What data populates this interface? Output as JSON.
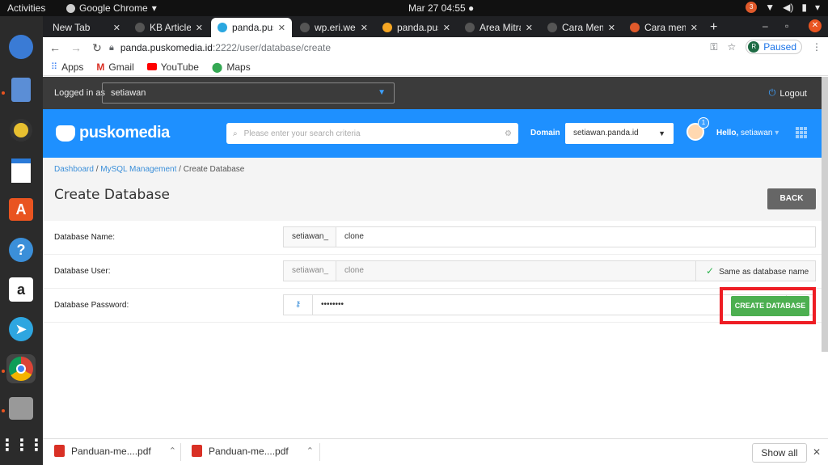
{
  "topbar": {
    "activities": "Activities",
    "app": "Google Chrome",
    "clock": "Mar 27  04:55",
    "notif_count": "3"
  },
  "tabs": [
    {
      "title": "New Tab",
      "fav": "#202124"
    },
    {
      "title": "KB Article",
      "fav": "#555"
    },
    {
      "title": "panda.pus",
      "fav": "#2aa7e0"
    },
    {
      "title": "wp.eri.wel",
      "fav": "#555"
    },
    {
      "title": "panda.pus",
      "fav": "#f5a623"
    },
    {
      "title": "Area Mitra",
      "fav": "#555"
    },
    {
      "title": "Cara Mem",
      "fav": "#555"
    },
    {
      "title": "Cara mem",
      "fav": "#e05a2b"
    }
  ],
  "toolbar": {
    "url_host": "panda.puskomedia.id",
    "url_path": ":2222/user/database/create",
    "profile_initial": "R",
    "profile_status": "Paused"
  },
  "bookmarks": [
    {
      "label": "Apps",
      "icon": "apps-grid-icon",
      "color": "#4285f4"
    },
    {
      "label": "Gmail",
      "icon": "gmail-icon",
      "color": "#d93025"
    },
    {
      "label": "YouTube",
      "icon": "youtube-icon",
      "color": "#ff0000"
    },
    {
      "label": "Maps",
      "icon": "maps-pin-icon",
      "color": "#34a853"
    }
  ],
  "page": {
    "logged_in_label": "Logged in as",
    "logged_in_user": "setiawan",
    "logout": "Logout",
    "brand": "puskomedia",
    "search_placeholder": "Please enter your search criteria",
    "domain_label": "Domain",
    "domain_value": "setiawan.panda.id",
    "notif_badge": "1",
    "hello_prefix": "Hello,",
    "hello_user": "setiawan",
    "breadcrumb": {
      "dashboard": "Dashboard",
      "sep1": " / ",
      "mysql": "MySQL Management",
      "sep2": " / ",
      "current": "Create Database"
    },
    "title": "Create Database",
    "back": "BACK",
    "form": {
      "db_name_label": "Database Name:",
      "db_name_prefix": "setiawan_",
      "db_name_value": "clone",
      "db_user_label": "Database User:",
      "db_user_prefix": "setiawan_",
      "db_user_value": "clone",
      "same_as": "Same as database name",
      "db_pass_label": "Database Password:",
      "db_pass_value": "••••••••"
    },
    "create": "CREATE DATABASE"
  },
  "downloads": {
    "items": [
      "Panduan-me....pdf",
      "Panduan-me....pdf"
    ],
    "show_all": "Show all"
  },
  "colors": {
    "brand_blue": "#1e90ff",
    "create_green": "#4caf50",
    "highlight_red": "#ee1d24"
  }
}
